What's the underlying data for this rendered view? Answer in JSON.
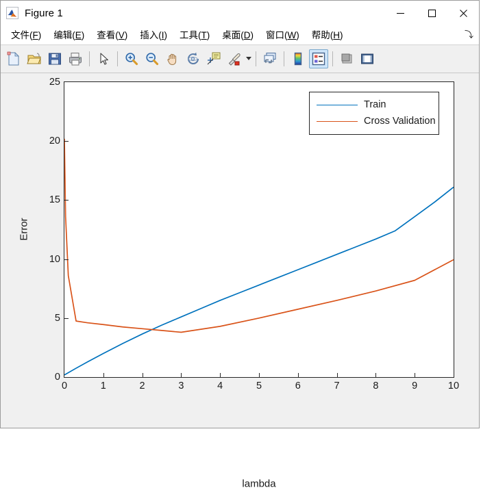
{
  "window": {
    "title": "Figure 1",
    "app_icon": "matlab-membrane-icon",
    "controls": {
      "minimize": "—",
      "maximize": "□",
      "close": "✕"
    }
  },
  "menubar": {
    "items": [
      {
        "name": "file",
        "text": "文件(F)",
        "pre": "文件(",
        "key": "F",
        "post": ")"
      },
      {
        "name": "edit",
        "text": "编辑(E)",
        "pre": "编辑(",
        "key": "E",
        "post": ")"
      },
      {
        "name": "view",
        "text": "查看(V)",
        "pre": "查看(",
        "key": "V",
        "post": ")"
      },
      {
        "name": "insert",
        "text": "插入(I)",
        "pre": "插入(",
        "key": "I",
        "post": ")"
      },
      {
        "name": "tools",
        "text": "工具(T)",
        "pre": "工具(",
        "key": "T",
        "post": ")"
      },
      {
        "name": "desktop",
        "text": "桌面(D)",
        "pre": "桌面(",
        "key": "D",
        "post": ")"
      },
      {
        "name": "window",
        "text": "窗口(W)",
        "pre": "窗口(",
        "key": "W",
        "post": ")"
      },
      {
        "name": "help",
        "text": "帮助(H)",
        "pre": "帮助(",
        "key": "H",
        "post": ")"
      }
    ],
    "undock_glyph": "⤵"
  },
  "toolbar": {
    "buttons": [
      {
        "name": "new-figure-icon",
        "tooltip": "New Figure"
      },
      {
        "name": "open-file-icon",
        "tooltip": "Open File"
      },
      {
        "name": "save-figure-icon",
        "tooltip": "Save Figure"
      },
      {
        "name": "print-figure-icon",
        "tooltip": "Print Figure"
      },
      {
        "name": "pointer-icon",
        "tooltip": "Edit Plot"
      },
      {
        "name": "zoom-in-icon",
        "tooltip": "Zoom In"
      },
      {
        "name": "zoom-out-icon",
        "tooltip": "Zoom Out"
      },
      {
        "name": "pan-hand-icon",
        "tooltip": "Pan"
      },
      {
        "name": "rotate-3d-icon",
        "tooltip": "Rotate 3D"
      },
      {
        "name": "data-cursor-icon",
        "tooltip": "Data Cursor"
      },
      {
        "name": "brush-icon",
        "tooltip": "Brush/Select Data"
      },
      {
        "name": "link-data-icon",
        "tooltip": "Link Plot"
      },
      {
        "name": "colorbar-icon",
        "tooltip": "Insert Colorbar"
      },
      {
        "name": "legend-icon",
        "tooltip": "Insert Legend",
        "active": true
      },
      {
        "name": "hide-plot-tools-icon",
        "tooltip": "Hide Plot Tools"
      },
      {
        "name": "show-plot-tools-icon",
        "tooltip": "Show Plot Tools and Dock Figure"
      }
    ]
  },
  "chart_data": {
    "type": "line",
    "title": "",
    "xlabel": "lambda",
    "ylabel": "Error",
    "xlim": [
      0,
      10
    ],
    "ylim": [
      0,
      25
    ],
    "xticks": [
      0,
      1,
      2,
      3,
      4,
      5,
      6,
      7,
      8,
      9,
      10
    ],
    "yticks": [
      0,
      5,
      10,
      15,
      20,
      25
    ],
    "grid": false,
    "legend_position": "top-right",
    "series": [
      {
        "name": "Train",
        "color": "#0072BD",
        "x": [
          0,
          0.3,
          0.6,
          1,
          1.5,
          2,
          2.5,
          3,
          3.5,
          4,
          4.5,
          5,
          5.5,
          6,
          6.5,
          7,
          7.5,
          8,
          8.5,
          9,
          9.5,
          10
        ],
        "y": [
          0.18,
          0.75,
          1.3,
          2.0,
          2.85,
          3.65,
          4.4,
          5.1,
          5.8,
          6.5,
          7.15,
          7.8,
          8.45,
          9.1,
          9.75,
          10.4,
          11.05,
          11.7,
          12.4,
          13.6,
          14.8,
          16.1
        ]
      },
      {
        "name": "Cross Validation",
        "color": "#D95319",
        "x": [
          0,
          0.03,
          0.1,
          0.3,
          0.6,
          1,
          1.5,
          2,
          2.5,
          3,
          4,
          5,
          6,
          7,
          8,
          9,
          10
        ],
        "y": [
          20.2,
          13.6,
          8.6,
          4.75,
          4.6,
          4.45,
          4.25,
          4.1,
          3.95,
          3.8,
          4.3,
          5.0,
          5.75,
          6.5,
          7.3,
          8.2,
          9.95
        ]
      }
    ]
  }
}
